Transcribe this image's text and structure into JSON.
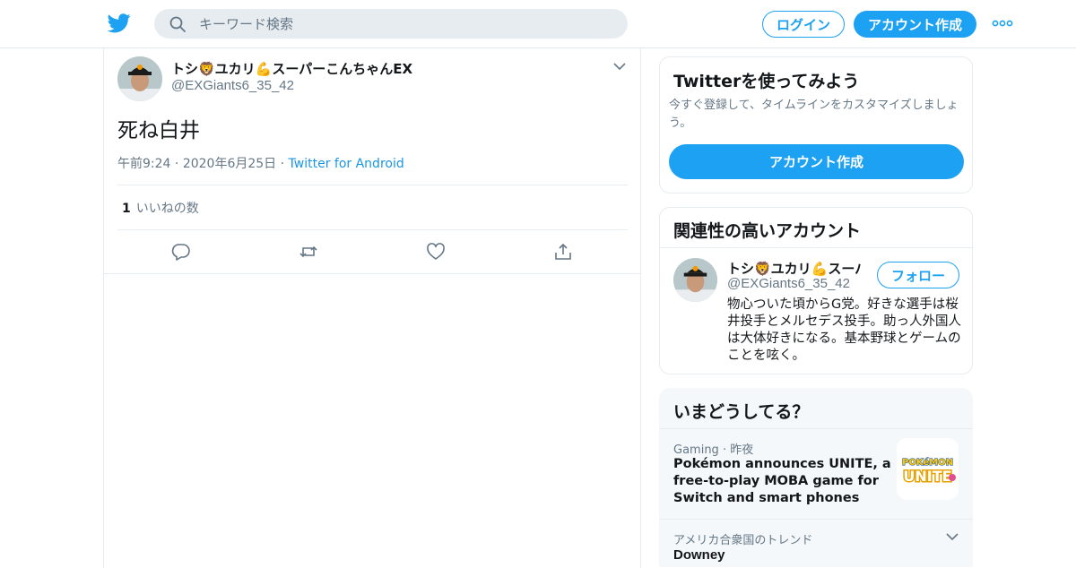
{
  "header": {
    "search_placeholder": "キーワード検索",
    "login_label": "ログイン",
    "signup_label": "アカウント作成",
    "brand_color": "#1da1f2"
  },
  "tweet": {
    "display_name": "トシ🦁ユカリ💪スーパーこんちゃんEX",
    "handle": "@EXGiants6_35_42",
    "text": "死ね白井",
    "time": "午前9:24",
    "date": "2020年6月25日",
    "source": "Twitter for Android",
    "like_count": "1",
    "like_label": "いいねの数",
    "actions": [
      "reply-icon",
      "retweet-icon",
      "like-icon",
      "share-icon"
    ]
  },
  "signup_card": {
    "title": "Twitterを使ってみよう",
    "description": "今すぐ登録して、タイムラインをカスタマイズしましょう。",
    "button_label": "アカウント作成"
  },
  "related_card": {
    "title": "関連性の高いアカウント",
    "name": "トシ🦁ユカリ💪スーパーこんちゃんEX",
    "handle": "@EXGiants6_35_42",
    "follow_label": "フォロー",
    "bio": "物心ついた頃からG党。好きな選手は桜井投手とメルセデス投手。助っ人外国人は大体好きになる。基本野球とゲームのことを呟く。"
  },
  "trends_card": {
    "title": "いまどうしてる？",
    "items": [
      {
        "category": "Gaming",
        "time": "昨夜",
        "title": "Pokémon announces UNITE, a free-to-play MOBA game for Switch and smart phones",
        "thumb_text_1": "POKéMON",
        "thumb_text_2": "UNITE"
      },
      {
        "category": "アメリカ合衆国のトレンド",
        "title": "Downey"
      }
    ]
  }
}
